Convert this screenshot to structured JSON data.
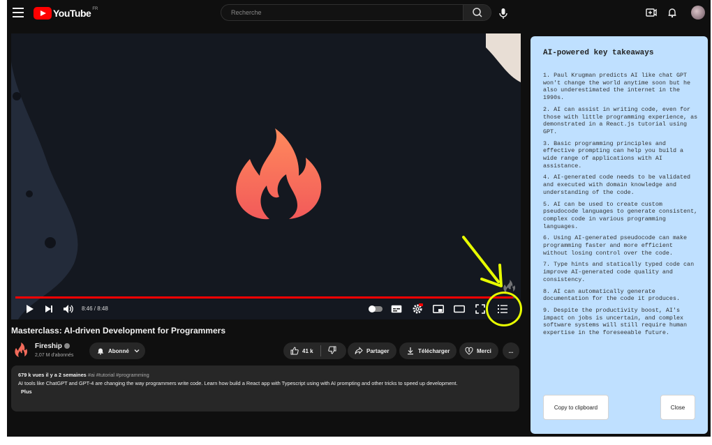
{
  "header": {
    "logo_text": "YouTube",
    "logo_country": "FR",
    "search_placeholder": "Recherche"
  },
  "player": {
    "time": "8:46 / 8:48",
    "progress": 0.996,
    "accent_color": "#ff0000",
    "highlight_color": "#e8ff00"
  },
  "video": {
    "title": "Masterclass: AI-driven Development for Programmers",
    "channel_name": "Fireship",
    "subscribers": "2,07 M d'abonnés",
    "subscribe_label": "Abonné",
    "likes": "41 k",
    "share_label": "Partager",
    "download_label": "Télécharger",
    "thanks_label": "Merci",
    "more_label": "..."
  },
  "description": {
    "meta": "679 k vues  il y a 2 semaines",
    "tags": "#ai #tutorial #programming",
    "text": "AI tools like ChatGPT and GPT-4 are changing the way programmers write code. Learn how build a React app with Typescript using with AI prompting and other tricks to speed up development.",
    "more": "Plus"
  },
  "panel": {
    "title": "AI-powered key takeaways",
    "points": [
      "1. Paul Krugman predicts AI like chat GPT won't change the world anytime soon but he also underestimated the internet in the 1990s.",
      "2. AI can assist in writing code, even for those with little programming experience, as demonstrated in a React.js tutorial using GPT.",
      "3. Basic programming principles and effective prompting can help you build a wide range of applications with AI assistance.",
      "4. AI-generated code needs to be validated and executed with domain knowledge and understanding of the code.",
      "5. AI can be used to create custom pseudocode languages to generate consistent, complex code in various programming languages.",
      "6. Using AI-generated pseudocode can make programming faster and more efficient without losing control over the code.",
      "7. Type hints and statically typed code can improve AI-generated code quality and consistency.",
      "8. AI can automatically generate documentation for the code it produces.",
      "9. Despite the productivity boost, AI's impact on jobs is uncertain, and complex software systems will still require human expertise in the foreseeable future."
    ],
    "copy_label": "Copy to clipboard",
    "close_label": "Close",
    "background_color": "#bfe0ff"
  }
}
